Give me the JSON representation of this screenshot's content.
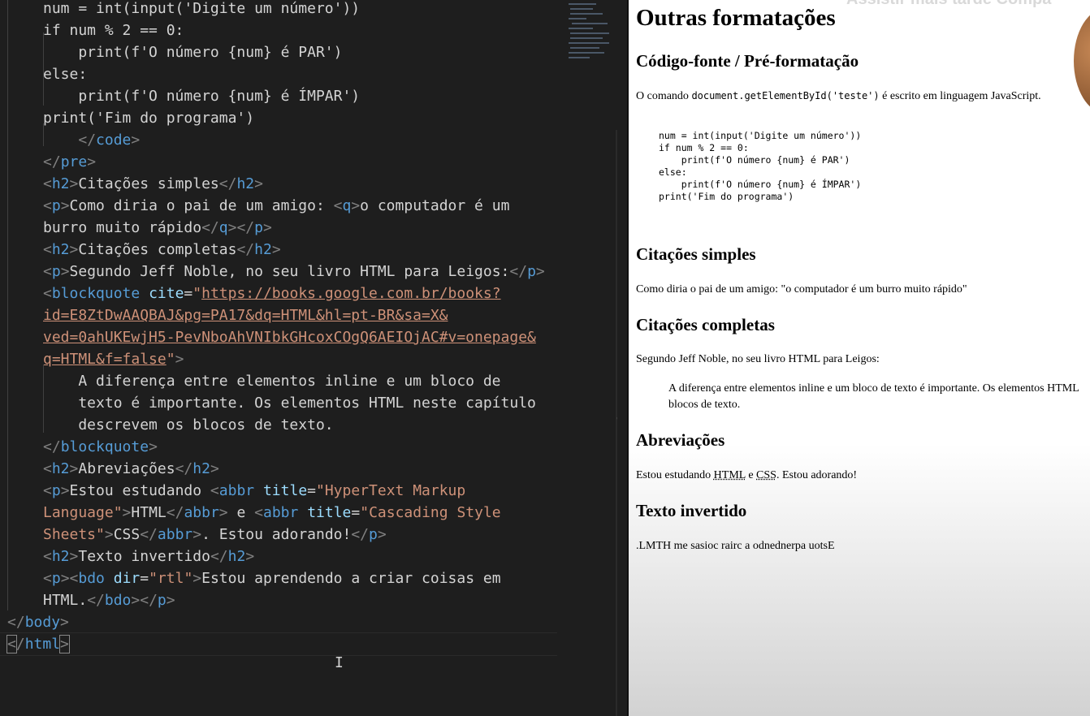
{
  "editor": {
    "lines": [
      [
        [
          "plain",
          "num = int(input('Digite um número'))"
        ]
      ],
      [
        [
          "plain",
          "if num % 2 == 0:"
        ]
      ],
      [
        [
          "plain",
          "    print(f'O número {num} é PAR')"
        ]
      ],
      [
        [
          "plain",
          "else:"
        ]
      ],
      [
        [
          "plain",
          "    print(f'O número {num} é ÍMPAR')"
        ]
      ],
      [
        [
          "plain",
          "print('Fim do programa')"
        ]
      ],
      [
        [
          "plain",
          "    "
        ],
        [
          "br",
          "</"
        ],
        [
          "tag",
          "code"
        ],
        [
          "br",
          ">"
        ]
      ],
      [
        [
          "br",
          "</"
        ],
        [
          "tag",
          "pre"
        ],
        [
          "br",
          ">"
        ]
      ],
      [
        [
          "br",
          "<"
        ],
        [
          "tag",
          "h2"
        ],
        [
          "br",
          ">"
        ],
        [
          "plain",
          "Citações simples"
        ],
        [
          "br",
          "</"
        ],
        [
          "tag",
          "h2"
        ],
        [
          "br",
          ">"
        ]
      ],
      [
        [
          "br",
          "<"
        ],
        [
          "tag",
          "p"
        ],
        [
          "br",
          ">"
        ],
        [
          "plain",
          "Como diria o pai de um amigo: "
        ],
        [
          "br",
          "<"
        ],
        [
          "tag",
          "q"
        ],
        [
          "br",
          ">"
        ],
        [
          "plain",
          "o computador é um"
        ]
      ],
      [
        [
          "plain",
          "burro muito rápido"
        ],
        [
          "br",
          "</"
        ],
        [
          "tag",
          "q"
        ],
        [
          "br",
          "></"
        ],
        [
          "tag",
          "p"
        ],
        [
          "br",
          ">"
        ]
      ],
      [
        [
          "br",
          "<"
        ],
        [
          "tag",
          "h2"
        ],
        [
          "br",
          ">"
        ],
        [
          "plain",
          "Citações completas"
        ],
        [
          "br",
          "</"
        ],
        [
          "tag",
          "h2"
        ],
        [
          "br",
          ">"
        ]
      ],
      [
        [
          "br",
          "<"
        ],
        [
          "tag",
          "p"
        ],
        [
          "br",
          ">"
        ],
        [
          "plain",
          "Segundo Jeff Noble, no seu livro HTML para Leigos:"
        ],
        [
          "br",
          "</"
        ],
        [
          "tag",
          "p"
        ],
        [
          "br",
          ">"
        ]
      ],
      [
        [
          "br",
          "<"
        ],
        [
          "tag",
          "blockquote"
        ],
        [
          "plain",
          " "
        ],
        [
          "attr",
          "cite"
        ],
        [
          "plain",
          "="
        ],
        [
          "str",
          "\""
        ],
        [
          "url",
          "https://books.google.com.br/books?"
        ]
      ],
      [
        [
          "url",
          "id=E8ZtDwAAQBAJ&pg=PA17&dq=HTML&hl=pt-BR&sa=X&"
        ]
      ],
      [
        [
          "url",
          "ved=0ahUKEwjH5-PevNboAhVNIbkGHcoxCOgQ6AEIOjAC#v=onepage&"
        ]
      ],
      [
        [
          "url",
          "q=HTML&f=false"
        ],
        [
          "str",
          "\""
        ],
        [
          "br",
          ">"
        ]
      ],
      [
        [
          "plain",
          "    A diferença entre elementos inline e um bloco de"
        ]
      ],
      [
        [
          "plain",
          "    texto é importante. Os elementos HTML neste capítulo"
        ]
      ],
      [
        [
          "plain",
          "    descrevem os blocos de texto."
        ]
      ],
      [
        [
          "br",
          "</"
        ],
        [
          "tag",
          "blockquote"
        ],
        [
          "br",
          ">"
        ]
      ],
      [
        [
          "br",
          "<"
        ],
        [
          "tag",
          "h2"
        ],
        [
          "br",
          ">"
        ],
        [
          "plain",
          "Abreviações"
        ],
        [
          "br",
          "</"
        ],
        [
          "tag",
          "h2"
        ],
        [
          "br",
          ">"
        ]
      ],
      [
        [
          "br",
          "<"
        ],
        [
          "tag",
          "p"
        ],
        [
          "br",
          ">"
        ],
        [
          "plain",
          "Estou estudando "
        ],
        [
          "br",
          "<"
        ],
        [
          "tag",
          "abbr"
        ],
        [
          "plain",
          " "
        ],
        [
          "attr",
          "title"
        ],
        [
          "plain",
          "="
        ],
        [
          "str",
          "\"HyperText Markup"
        ]
      ],
      [
        [
          "str",
          "Language\""
        ],
        [
          "br",
          ">"
        ],
        [
          "plain",
          "HTML"
        ],
        [
          "br",
          "</"
        ],
        [
          "tag",
          "abbr"
        ],
        [
          "br",
          ">"
        ],
        [
          "plain",
          " e "
        ],
        [
          "br",
          "<"
        ],
        [
          "tag",
          "abbr"
        ],
        [
          "plain",
          " "
        ],
        [
          "attr",
          "title"
        ],
        [
          "plain",
          "="
        ],
        [
          "str",
          "\"Cascading Style"
        ]
      ],
      [
        [
          "str",
          "Sheets\""
        ],
        [
          "br",
          ">"
        ],
        [
          "plain",
          "CSS"
        ],
        [
          "br",
          "</"
        ],
        [
          "tag",
          "abbr"
        ],
        [
          "br",
          ">"
        ],
        [
          "plain",
          ". Estou adorando!"
        ],
        [
          "br",
          "</"
        ],
        [
          "tag",
          "p"
        ],
        [
          "br",
          ">"
        ]
      ],
      [
        [
          "br",
          "<"
        ],
        [
          "tag",
          "h2"
        ],
        [
          "br",
          ">"
        ],
        [
          "plain",
          "Texto invertido"
        ],
        [
          "br",
          "</"
        ],
        [
          "tag",
          "h2"
        ],
        [
          "br",
          ">"
        ]
      ],
      [
        [
          "br",
          "<"
        ],
        [
          "tag",
          "p"
        ],
        [
          "br",
          "><"
        ],
        [
          "tag",
          "bdo"
        ],
        [
          "plain",
          " "
        ],
        [
          "attr",
          "dir"
        ],
        [
          "plain",
          "="
        ],
        [
          "str",
          "\"rtl\""
        ],
        [
          "br",
          ">"
        ],
        [
          "plain",
          "Estou aprendendo a criar coisas em"
        ]
      ],
      [
        [
          "plain",
          "HTML."
        ],
        [
          "br",
          "</"
        ],
        [
          "tag",
          "bdo"
        ],
        [
          "br",
          "></"
        ],
        [
          "tag",
          "p"
        ],
        [
          "br",
          ">"
        ]
      ],
      [
        [
          "br",
          "</"
        ],
        [
          "tag",
          "body"
        ],
        [
          "br",
          ">"
        ]
      ],
      [
        [
          "brbox",
          "<"
        ],
        [
          "br",
          "/"
        ],
        [
          "tag",
          "html"
        ],
        [
          "brbox",
          ">"
        ]
      ]
    ]
  },
  "preview": {
    "overlay_title": "Assistir mais tarde     Compa",
    "h1": "Outras formatações",
    "h2_codigo": "Código-fonte / Pré-formatação",
    "p_comando_before": "O comando ",
    "p_comando_code": "document.getElementById('teste')",
    "p_comando_after": " é escrito em linguagem JavaScript.",
    "pre": "num = int(input('Digite um número'))\nif num % 2 == 0:\n    print(f'O número {num} é PAR')\nelse:\n    print(f'O número {num} é ÍMPAR')\nprint('Fim do programa')",
    "h2_citacoes_simples": "Citações simples",
    "p_citacao": "Como diria o pai de um amigo: \"o computador é um burro muito rápido\"",
    "h2_citacoes_completas": "Citações completas",
    "p_segundo": "Segundo Jeff Noble, no seu livro HTML para Leigos:",
    "quote_line1": "A diferença entre elementos inline e um bloco de texto é importante. Os elementos HTML",
    "quote_line2": "blocos de texto.",
    "h2_abreviacoes": "Abreviações",
    "p_abbr_before": "Estou estudando ",
    "abbr_html": "HTML",
    "p_abbr_mid": " e ",
    "abbr_css": "CSS",
    "p_abbr_after": ". Estou adorando!",
    "h2_texto_invertido": "Texto invertido",
    "p_invertido": ".LMTH me sasioc rairc a odnednerpa uotsE"
  },
  "colors": {
    "editor_bg": "#1e1e1e",
    "tag": "#569cd6",
    "bracket": "#808080",
    "attribute": "#9cdcfe",
    "string": "#ce9178",
    "text": "#d4d4d4"
  }
}
